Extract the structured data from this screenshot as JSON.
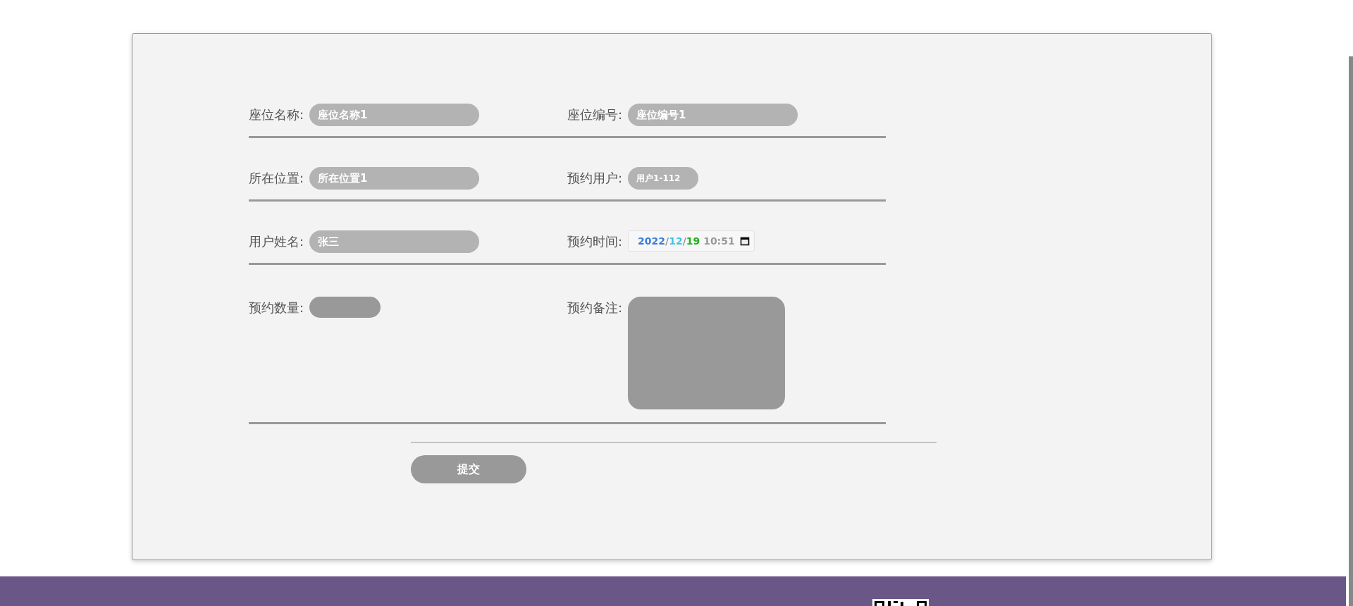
{
  "form": {
    "rows": [
      {
        "fields": [
          {
            "label": "座位名称:",
            "kind": "text",
            "value": "座位名称1"
          },
          {
            "label": "座位编号:",
            "kind": "text",
            "value": "座位编号1"
          }
        ]
      },
      {
        "fields": [
          {
            "label": "所在位置:",
            "kind": "text",
            "value": "所在位置1"
          },
          {
            "label": "预约用户:",
            "kind": "short_text",
            "value": "用户1-112"
          }
        ]
      },
      {
        "fields": [
          {
            "label": "用户姓名:",
            "kind": "text",
            "value": "张三"
          },
          {
            "label": "预约时间:",
            "kind": "datetime",
            "parts": [
              {
                "text": "2022",
                "color": "#3b7ddd"
              },
              {
                "text": "/",
                "color": "#999999"
              },
              {
                "text": "12",
                "color": "#3ec3e8"
              },
              {
                "text": "/",
                "color": "#999999"
              },
              {
                "text": "19",
                "color": "#20b020"
              },
              {
                "text": " 10:51",
                "color": "#999999"
              }
            ]
          }
        ]
      },
      {
        "fields": [
          {
            "label": "预约数量:",
            "kind": "number"
          },
          {
            "label": "预约备注:",
            "kind": "textarea"
          }
        ]
      }
    ],
    "submit": "提交"
  }
}
